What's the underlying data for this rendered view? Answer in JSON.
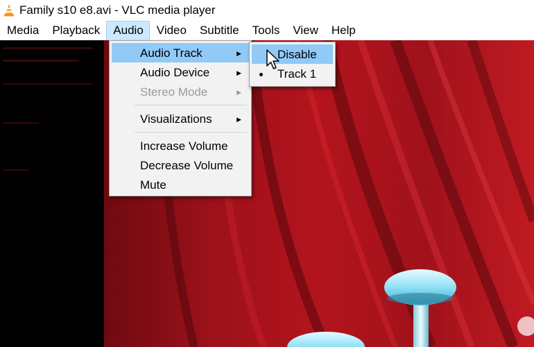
{
  "window": {
    "title": "Family s10 e8.avi - VLC media player"
  },
  "menubar": {
    "items": [
      {
        "label": "Media"
      },
      {
        "label": "Playback"
      },
      {
        "label": "Audio"
      },
      {
        "label": "Video"
      },
      {
        "label": "Subtitle"
      },
      {
        "label": "Tools"
      },
      {
        "label": "View"
      },
      {
        "label": "Help"
      }
    ],
    "active_item": "Audio"
  },
  "audio_menu": {
    "items": [
      {
        "label": "Audio Track",
        "has_submenu": true,
        "state": "highlighted"
      },
      {
        "label": "Audio Device",
        "has_submenu": true,
        "state": "enabled"
      },
      {
        "label": "Stereo Mode",
        "has_submenu": true,
        "state": "disabled"
      },
      {
        "label": "Visualizations",
        "has_submenu": true,
        "state": "enabled"
      },
      {
        "label": "Increase Volume",
        "state": "enabled"
      },
      {
        "label": "Decrease Volume",
        "state": "enabled"
      },
      {
        "label": "Mute",
        "state": "enabled"
      }
    ]
  },
  "audio_track_submenu": {
    "items": [
      {
        "label": "Disable",
        "state": "highlighted",
        "selected": false
      },
      {
        "label": "Track 1",
        "state": "enabled",
        "selected": true
      }
    ]
  },
  "icons": {
    "app": "vlc-cone-icon",
    "submenu": "triangle-right-icon",
    "radio": "radio-dot-icon",
    "pointer": "mouse-pointer-icon"
  },
  "colors": {
    "menu_highlight": "#91c9f7",
    "menubar_active": "#cce8ff",
    "menu_background": "#f2f2f2",
    "disabled_text": "#9a9a9a",
    "vlc_orange": "#f7941d",
    "curtain_red": "#a8121b"
  }
}
